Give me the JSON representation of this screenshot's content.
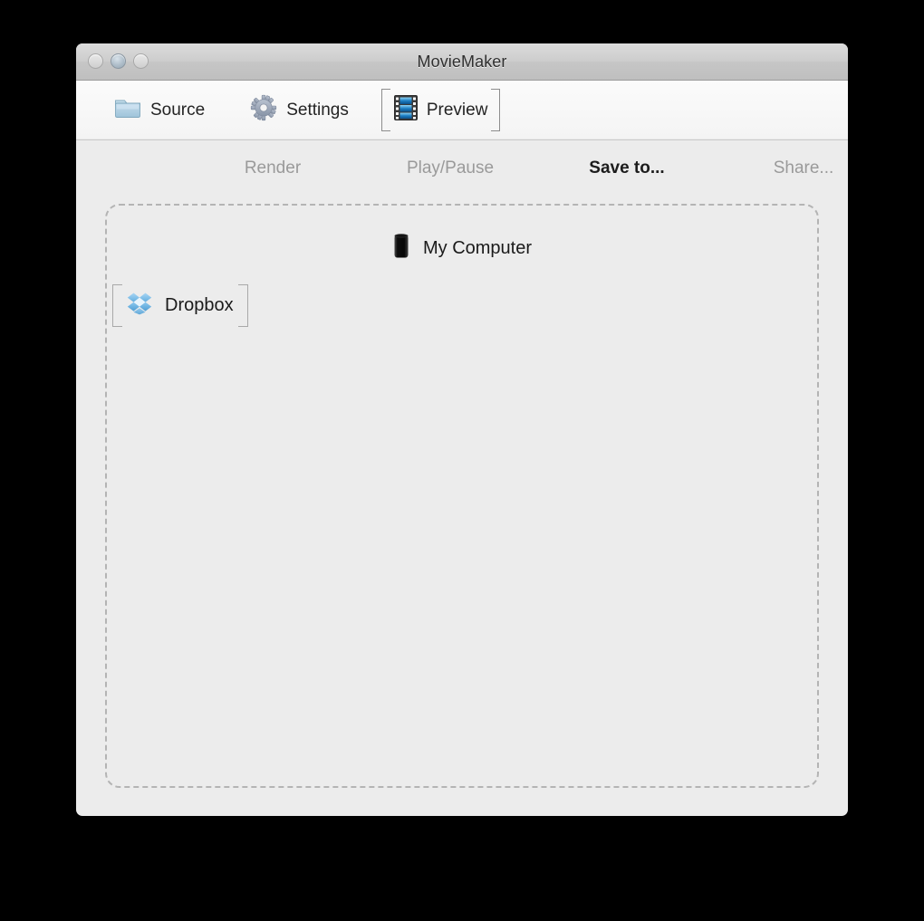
{
  "window": {
    "title": "MovieMaker",
    "controls": [
      {
        "name": "close-button",
        "state": "inactive"
      },
      {
        "name": "minimize-button",
        "state": "inactive-highlighted"
      },
      {
        "name": "zoom-button",
        "state": "inactive"
      }
    ]
  },
  "toolbar": {
    "tabs": [
      {
        "label": "Source",
        "icon": "folder-icon",
        "selected": false
      },
      {
        "label": "Settings",
        "icon": "gear-icon",
        "selected": false
      },
      {
        "label": "Preview",
        "icon": "film-strip-icon",
        "selected": true
      }
    ]
  },
  "subtabs": {
    "items": [
      {
        "label": "Render",
        "active": false
      },
      {
        "label": "Play/Pause",
        "active": false
      },
      {
        "label": "Save to...",
        "active": true
      },
      {
        "label": "Share...",
        "active": false
      }
    ]
  },
  "main": {
    "destinations": [
      {
        "label": "My Computer",
        "icon": "mac-pro-icon",
        "selected": false
      },
      {
        "label": "Dropbox",
        "icon": "dropbox-icon",
        "selected": true
      }
    ]
  },
  "colors": {
    "window_background": "#ececec",
    "toolbar_background": "#f7f7f7",
    "titlebar_top": "#dcdcdc",
    "titlebar_bottom": "#bfbfbf",
    "active_text": "#1c1c1c",
    "inactive_text": "#9a9a9a",
    "dashed_border": "#b4b4b4",
    "selection_bracket": "#8d8d8d",
    "folder_blue": "#a8cade",
    "gear_gray": "#98a3b5",
    "dropbox_blue": "#7ab8e8",
    "desktop_background": "#000000"
  }
}
